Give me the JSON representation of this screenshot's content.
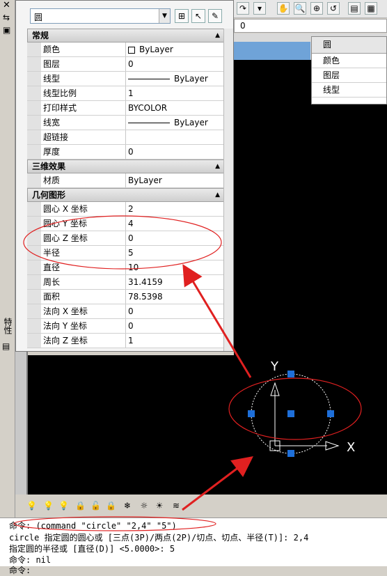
{
  "object_selector": {
    "selected": "圆"
  },
  "properties": {
    "sections": [
      {
        "title": "常规",
        "rows": [
          {
            "name": "颜色",
            "value": "ByLayer",
            "swatch": "color-box"
          },
          {
            "name": "图层",
            "value": "0"
          },
          {
            "name": "线型",
            "value": "ByLayer",
            "swatch": "line"
          },
          {
            "name": "线型比例",
            "value": "1"
          },
          {
            "name": "打印样式",
            "value": "BYCOLOR"
          },
          {
            "name": "线宽",
            "value": "ByLayer",
            "swatch": "line"
          },
          {
            "name": "超链接",
            "value": ""
          },
          {
            "name": "厚度",
            "value": "0"
          }
        ]
      },
      {
        "title": "三维效果",
        "rows": [
          {
            "name": "材质",
            "value": "ByLayer"
          }
        ]
      },
      {
        "title": "几何图形",
        "rows": [
          {
            "name": "圆心 X 坐标",
            "value": "2"
          },
          {
            "name": "圆心 Y 坐标",
            "value": "4"
          },
          {
            "name": "圆心 Z 坐标",
            "value": "0"
          },
          {
            "name": "半径",
            "value": "5"
          },
          {
            "name": "直径",
            "value": "10"
          },
          {
            "name": "周长",
            "value": "31.4159"
          },
          {
            "name": "面积",
            "value": "78.5398"
          },
          {
            "name": "法向 X 坐标",
            "value": "0"
          },
          {
            "name": "法向 Y 坐标",
            "value": "0"
          },
          {
            "name": "法向 Z 坐标",
            "value": "1"
          }
        ]
      }
    ]
  },
  "side_label": "特性",
  "layer_combo": {
    "value": "0"
  },
  "mini_panel": {
    "title": "圆",
    "rows": [
      "颜色",
      "图层",
      "线型"
    ]
  },
  "canvas": {
    "axis_y": "Y",
    "axis_x": "X"
  },
  "command_lines": [
    "命令: (command \"circle\" \"2,4\" \"5\")",
    "circle 指定圆的圆心或 [三点(3P)/两点(2P)/切点、切点、半径(T)]: 2,4",
    "指定圆的半径或 [直径(D)] <5.0000>: 5",
    "命令: nil",
    "命令:"
  ],
  "colors": {
    "annotation_red": "#e02020",
    "grip_blue": "#1e6fd9",
    "canvas_bg": "#000000"
  }
}
